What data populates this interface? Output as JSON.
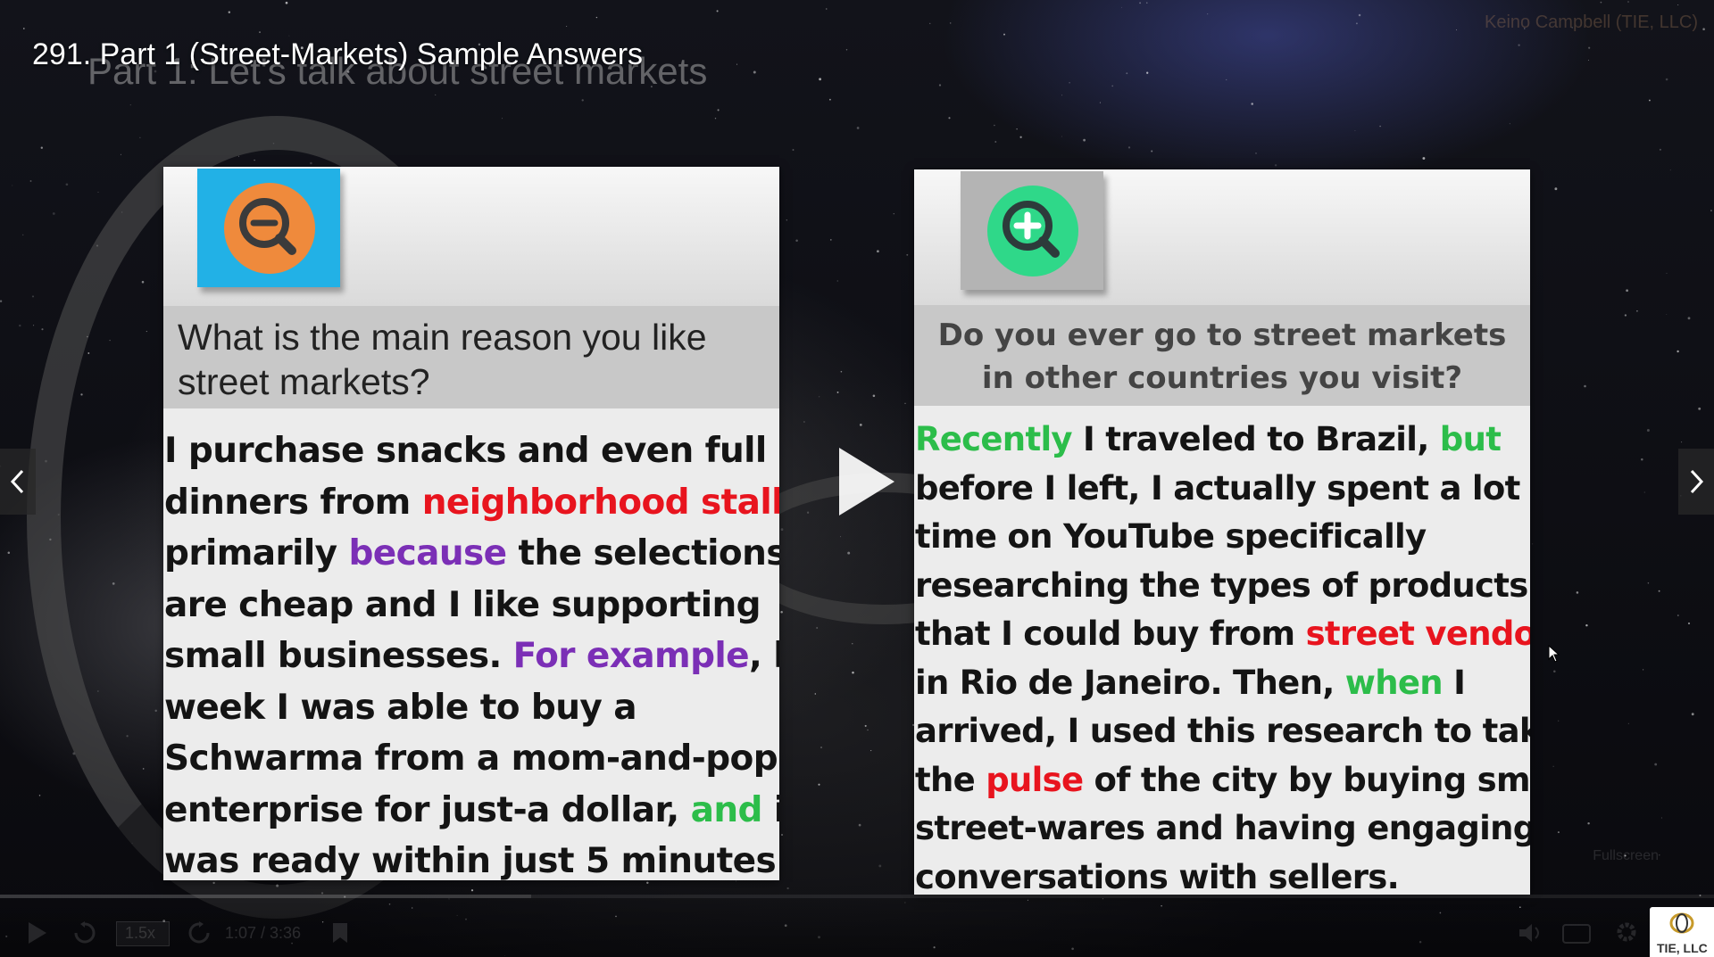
{
  "player": {
    "video_title": "291. Part 1 (Street-Markets) Sample Answers",
    "author_watermark": "Keino Campbell (TIE, LLC)",
    "time_display": "1:07 / 3:36",
    "playback_speed": "1.5x",
    "fullscreen_tooltip": "Fullscreen",
    "progress_fraction": 0.31,
    "logo_text": "TIE, LLC"
  },
  "slide": {
    "heading": "Part 1: Let's talk about street markets",
    "left_card": {
      "icon": "zoom-out-icon",
      "question": "What is the main reason you like street markets?",
      "answer_lines": [
        [
          {
            "t": "I purchase snacks and even full"
          }
        ],
        [
          {
            "t": "dinners from "
          },
          {
            "t": "neighborhood stalls",
            "c": "red"
          }
        ],
        [
          {
            "t": "primarily "
          },
          {
            "t": "because",
            "c": "purple"
          },
          {
            "t": " the selections"
          }
        ],
        [
          {
            "t": "are cheap and I like supporting"
          }
        ],
        [
          {
            "t": "small businesses. "
          },
          {
            "t": "For example",
            "c": "purple"
          },
          {
            "t": ", last"
          }
        ],
        [
          {
            "t": "week I was able to buy a"
          }
        ],
        [
          {
            "t": "Schwarma from a mom-and-pop"
          }
        ],
        [
          {
            "t": "enterprise for just-a dollar, "
          },
          {
            "t": "and",
            "c": "green"
          },
          {
            "t": " it"
          }
        ],
        [
          {
            "t": "was ready within just 5 minutes."
          }
        ]
      ]
    },
    "right_card": {
      "icon": "zoom-in-icon",
      "question": "Do you ever go to street markets in other countries you visit?",
      "answer_lines": [
        [
          {
            "t": "Recently",
            "c": "green"
          },
          {
            "t": " I traveled to Brazil, "
          },
          {
            "t": "but",
            "c": "green"
          }
        ],
        [
          {
            "t": "before I left, I actually spent a lot of"
          }
        ],
        [
          {
            "t": "time on YouTube specifically"
          }
        ],
        [
          {
            "t": "researching the types of products"
          }
        ],
        [
          {
            "t": "that I could buy from "
          },
          {
            "t": "street vendors",
            "c": "red"
          }
        ],
        [
          {
            "t": "in Rio de Janeiro. Then, "
          },
          {
            "t": "when",
            "c": "green"
          },
          {
            "t": " I"
          }
        ],
        [
          {
            "t": "arrived, I used this research to take"
          }
        ],
        [
          {
            "t": "the "
          },
          {
            "t": "pulse",
            "c": "red"
          },
          {
            "t": " of the city by buying small"
          }
        ],
        [
          {
            "t": "street-wares and having engaging"
          }
        ],
        [
          {
            "t": "conversations with sellers."
          }
        ]
      ]
    }
  },
  "colors": {
    "red": "#e8141e",
    "purple": "#7b2fb6",
    "green": "#2cbd4a",
    "zoom_out_tile": "#22b1e6",
    "zoom_out_circle": "#ef8a3c",
    "zoom_in_tile": "#b4b4b4",
    "zoom_in_circle": "#2fd889"
  }
}
